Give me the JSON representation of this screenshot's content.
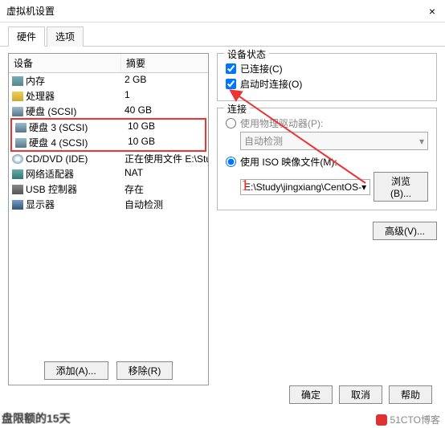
{
  "window": {
    "title": "虚拟机设置",
    "close": "×"
  },
  "tabs": {
    "hardware": "硬件",
    "options": "选项"
  },
  "columns": {
    "device": "设备",
    "summary": "摘要"
  },
  "devices": [
    {
      "icon": "ic-mem",
      "name": "内存",
      "summary": "2 GB"
    },
    {
      "icon": "ic-cpu",
      "name": "处理器",
      "summary": "1"
    },
    {
      "icon": "ic-disk",
      "name": "硬盘 (SCSI)",
      "summary": "40 GB"
    },
    {
      "icon": "ic-disk",
      "name": "硬盘 3 (SCSI)",
      "summary": "10 GB"
    },
    {
      "icon": "ic-disk",
      "name": "硬盘 4 (SCSI)",
      "summary": "10 GB"
    },
    {
      "icon": "ic-cd",
      "name": "CD/DVD (IDE)",
      "summary": "正在使用文件 E:\\Study\\jingxian..."
    },
    {
      "icon": "ic-net",
      "name": "网络适配器",
      "summary": "NAT"
    },
    {
      "icon": "ic-usb",
      "name": "USB 控制器",
      "summary": "存在"
    },
    {
      "icon": "ic-disp",
      "name": "显示器",
      "summary": "自动检测"
    }
  ],
  "left_buttons": {
    "add": "添加(A)...",
    "remove": "移除(R)"
  },
  "status_group": {
    "title": "设备状态",
    "connected": "已连接(C)",
    "connect_at_power": "启动时连接(O)"
  },
  "connection_group": {
    "title": "连接",
    "use_physical": "使用物理驱动器(P):",
    "auto_detect": "自动检测",
    "use_iso": "使用 ISO 映像文件(M):",
    "iso_path": "E:\\Study\\jingxiang\\CentOS-",
    "browse": "浏览(B)...",
    "dropdown_arrow": "▾"
  },
  "advanced": "高级(V)...",
  "footer": {
    "ok": "确定",
    "cancel": "取消",
    "help": "帮助"
  },
  "annotation": "1",
  "watermark": "51CTO博客",
  "bgtext": "盘限额的15天"
}
